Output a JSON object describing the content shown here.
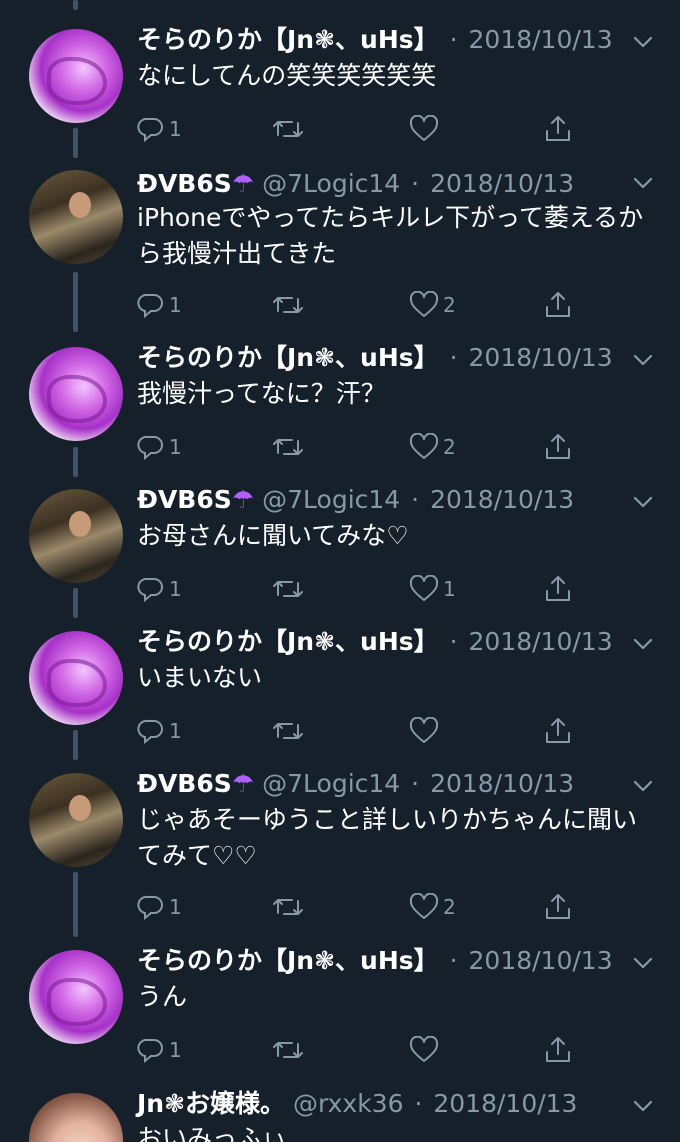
{
  "tweets": [
    {
      "name": "そらのりか【Jn❃、uHs】",
      "handle": "",
      "dot": "·",
      "date": "2018/10/13",
      "text": "なにしてんの笑笑笑笑笑笑",
      "replies": "1",
      "retweets": "",
      "likes": "",
      "avatar": "pink"
    },
    {
      "name": "ĐVB6S☂",
      "handle": "@7Logic14",
      "dot": "·",
      "date": "2018/10/13",
      "text": "iPhoneでやってたらキルレ下がって萎えるから我慢汁出てきた",
      "replies": "1",
      "retweets": "",
      "likes": "2",
      "avatar": "photo"
    },
    {
      "name": "そらのりか【Jn❃、uHs】",
      "handle": "",
      "dot": "·",
      "date": "2018/10/13",
      "text": "我慢汁ってなに？汗？",
      "replies": "1",
      "retweets": "",
      "likes": "2",
      "avatar": "pink"
    },
    {
      "name": "ĐVB6S☂",
      "handle": "@7Logic14",
      "dot": "·",
      "date": "2018/10/13",
      "text": "お母さんに聞いてみな♡",
      "replies": "1",
      "retweets": "",
      "likes": "1",
      "avatar": "photo"
    },
    {
      "name": "そらのりか【Jn❃、uHs】",
      "handle": "",
      "dot": "·",
      "date": "2018/10/13",
      "text": "いまいない",
      "replies": "1",
      "retweets": "",
      "likes": "",
      "avatar": "pink"
    },
    {
      "name": "ĐVB6S☂",
      "handle": "@7Logic14",
      "dot": "·",
      "date": "2018/10/13",
      "text": "じゃあそーゆうこと詳しいりかちゃんに聞いてみて♡♡",
      "replies": "1",
      "retweets": "",
      "likes": "2",
      "avatar": "photo"
    },
    {
      "name": "そらのりか【Jn❃、uHs】",
      "handle": "",
      "dot": "·",
      "date": "2018/10/13",
      "text": "うん",
      "replies": "1",
      "retweets": "",
      "likes": "",
      "avatar": "pink"
    },
    {
      "name": "Jn❃お嬢様。",
      "handle": "@rxxk36",
      "dot": "·",
      "date": "2018/10/13",
      "text": "おいみっふぃ",
      "replies": "",
      "retweets": "",
      "likes": "",
      "avatar": "girl"
    }
  ],
  "icons": {
    "reply": "reply-icon",
    "retweet": "retweet-icon",
    "like": "heart-icon",
    "share": "share-icon",
    "menu": "chevron-down-icon"
  },
  "colors": {
    "background": "#15202b",
    "secondary_text": "#8899a6",
    "thread_line": "#3d5466"
  }
}
